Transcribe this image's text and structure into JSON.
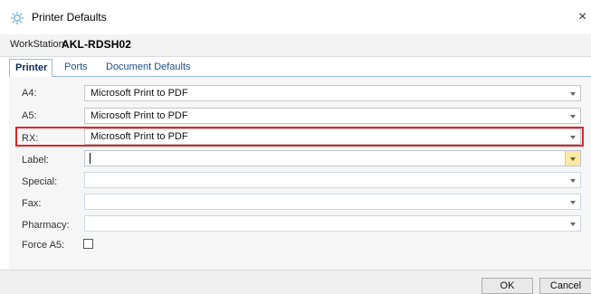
{
  "window": {
    "title": "Printer Defaults",
    "icon": "gear-icon",
    "close_glyph": "×"
  },
  "workstation": {
    "label": "WorkStation:",
    "value": "AKL-RDSH02"
  },
  "tabs": [
    {
      "label": "Printer",
      "active": true
    },
    {
      "label": "Ports",
      "active": false
    },
    {
      "label": "Document Defaults",
      "active": false
    }
  ],
  "fields": {
    "a4": {
      "label": "A4:",
      "value": "Microsoft Print to PDF"
    },
    "a5": {
      "label": "A5:",
      "value": "Microsoft Print to PDF"
    },
    "rx": {
      "label": "RX:",
      "value": "Microsoft Print to PDF"
    },
    "label_printer": {
      "label": "Label:",
      "value": ""
    },
    "special": {
      "label": "Special:",
      "value": ""
    },
    "fax": {
      "label": "Fax:",
      "value": ""
    },
    "pharmacy": {
      "label": "Pharmacy:",
      "value": ""
    },
    "force_a5": {
      "label": "Force A5:",
      "checked": false
    }
  },
  "buttons": {
    "ok": "OK",
    "cancel": "Cancel"
  },
  "colors": {
    "highlight": "#e0242b",
    "tab_text": "#1f4e89",
    "focus_arrow": "#fde9a6"
  }
}
